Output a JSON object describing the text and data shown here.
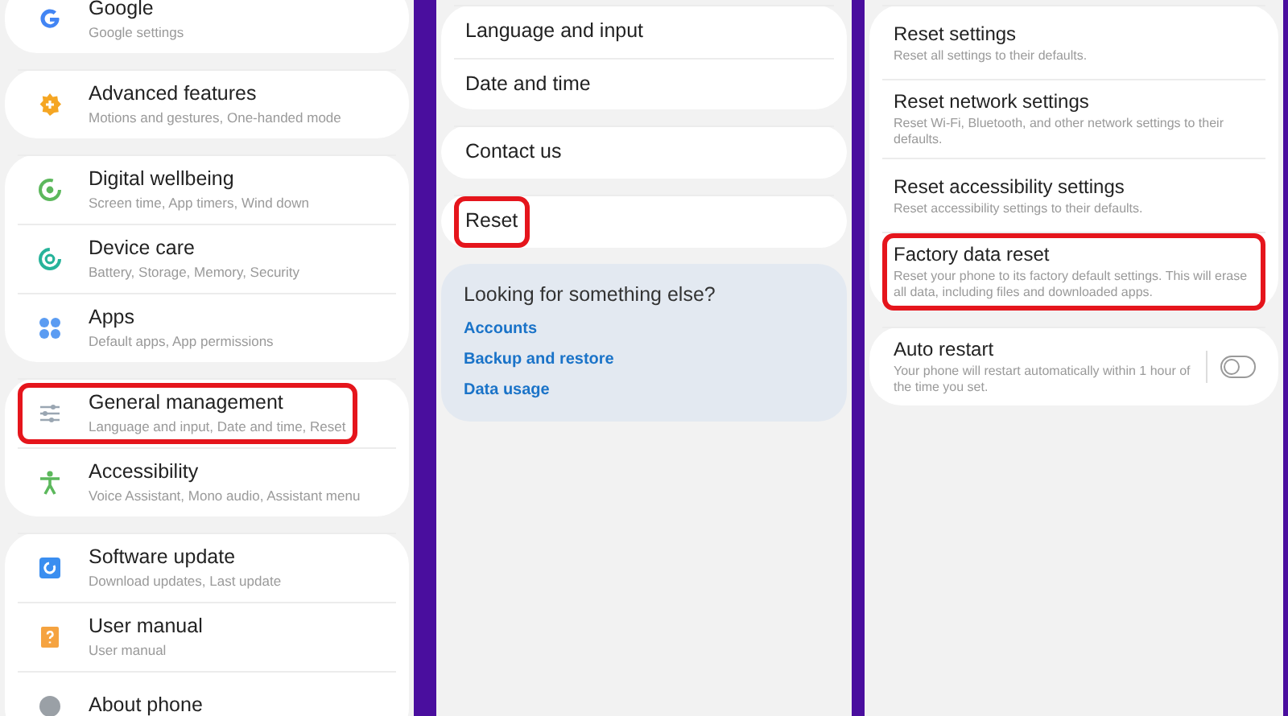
{
  "settings_list": {
    "groups": [
      {
        "items": [
          {
            "title": "Google",
            "subtitle": "Google settings",
            "highlighted": false
          }
        ]
      },
      {
        "items": [
          {
            "title": "Advanced features",
            "subtitle": "Motions and gestures, One-handed mode",
            "highlighted": false
          }
        ]
      },
      {
        "items": [
          {
            "title": "Digital wellbeing",
            "subtitle": "Screen time, App timers, Wind down",
            "highlighted": false
          },
          {
            "title": "Device care",
            "subtitle": "Battery, Storage, Memory, Security",
            "highlighted": false
          },
          {
            "title": "Apps",
            "subtitle": "Default apps, App permissions",
            "highlighted": false
          }
        ]
      },
      {
        "items": [
          {
            "title": "General management",
            "subtitle": "Language and input, Date and time, Reset",
            "highlighted": true
          },
          {
            "title": "Accessibility",
            "subtitle": "Voice Assistant, Mono audio, Assistant menu",
            "highlighted": false
          }
        ]
      },
      {
        "items": [
          {
            "title": "Software update",
            "subtitle": "Download updates, Last update",
            "highlighted": false
          },
          {
            "title": "User manual",
            "subtitle": "User manual",
            "highlighted": false
          },
          {
            "title": "About phone",
            "highlighted": false
          }
        ]
      }
    ]
  },
  "general_management": {
    "groups": [
      {
        "items": [
          {
            "title": "Language and input",
            "highlighted": false
          },
          {
            "title": "Date and time",
            "highlighted": false
          }
        ]
      },
      {
        "items": [
          {
            "title": "Contact us",
            "highlighted": false
          }
        ]
      },
      {
        "items": [
          {
            "title": "Reset",
            "highlighted": true
          }
        ]
      }
    ],
    "suggestions": {
      "heading": "Looking for something else?",
      "links": [
        "Accounts",
        "Backup and restore",
        "Data usage"
      ]
    }
  },
  "reset": {
    "groups": [
      {
        "items": [
          {
            "kind": "plain",
            "title": "Reset settings",
            "subtitle": "Reset all settings to their defaults.",
            "highlighted": false
          },
          {
            "kind": "plain",
            "title": "Reset network settings",
            "subtitle": "Reset Wi-Fi, Bluetooth, and other network settings to their defaults.",
            "highlighted": false
          },
          {
            "kind": "plain",
            "title": "Reset accessibility settings",
            "subtitle": "Reset accessibility settings to their defaults.",
            "highlighted": false
          },
          {
            "kind": "plain",
            "title": "Factory data reset",
            "subtitle": "Reset your phone to its factory default settings. This will erase all data, including files and downloaded apps.",
            "highlighted": true
          }
        ]
      },
      {
        "items": [
          {
            "kind": "toggle",
            "title": "Auto restart",
            "subtitle": "Your phone will restart automatically within 1 hour of the time you set.",
            "highlighted": false,
            "on": false
          }
        ]
      }
    ]
  }
}
